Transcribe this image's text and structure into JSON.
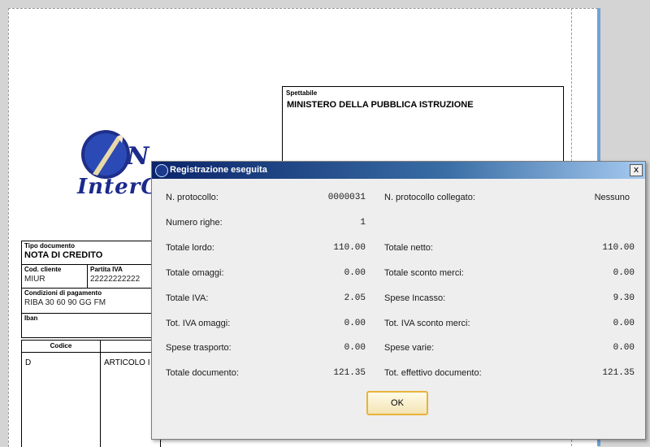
{
  "document": {
    "recipient_label": "Spettabile",
    "recipient_name": "MINISTERO DELLA PUBBLICA ISTRUZIONE",
    "logo_text": "InterG",
    "tipo_documento_label": "Tipo documento",
    "tipo_documento_value": "NOTA DI CREDITO",
    "cod_cliente_label": "Cod. cliente",
    "cod_cliente_value": "MIUR",
    "partita_iva_label": "Partita IVA",
    "partita_iva_value": "22222222222",
    "condizioni_label": "Condizioni di pagamento",
    "condizioni_value": "RIBA 30 60 90 GG FM",
    "iban_label": "Iban",
    "codice_header": "Codice",
    "row_code": "D",
    "row_desc": "ARTICOLO I"
  },
  "dialog": {
    "title": "Registrazione eseguita",
    "close_glyph": "x",
    "ok_label": "OK",
    "left": [
      {
        "label": "N. protocollo:",
        "value": "0000031"
      },
      {
        "label": "Numero righe:",
        "value": "1"
      },
      {
        "label": "Totale lordo:",
        "value": "110.00"
      },
      {
        "label": "Totale omaggi:",
        "value": "0.00"
      },
      {
        "label": "Totale IVA:",
        "value": "2.05"
      },
      {
        "label": "Tot. IVA omaggi:",
        "value": "0.00"
      },
      {
        "label": "Spese trasporto:",
        "value": "0.00"
      },
      {
        "label": "Totale documento:",
        "value": "121.35"
      }
    ],
    "right": [
      {
        "label": "N. protocollo collegato:",
        "value": "Nessuno"
      },
      {
        "label": "",
        "value": ""
      },
      {
        "label": "Totale netto:",
        "value": "110.00"
      },
      {
        "label": "Totale sconto merci:",
        "value": "0.00"
      },
      {
        "label": "Spese Incasso:",
        "value": "9.30"
      },
      {
        "label": "Tot. IVA sconto merci:",
        "value": "0.00"
      },
      {
        "label": "Spese varie:",
        "value": "0.00"
      },
      {
        "label": "Tot. effettivo documento:",
        "value": "121.35"
      }
    ]
  }
}
